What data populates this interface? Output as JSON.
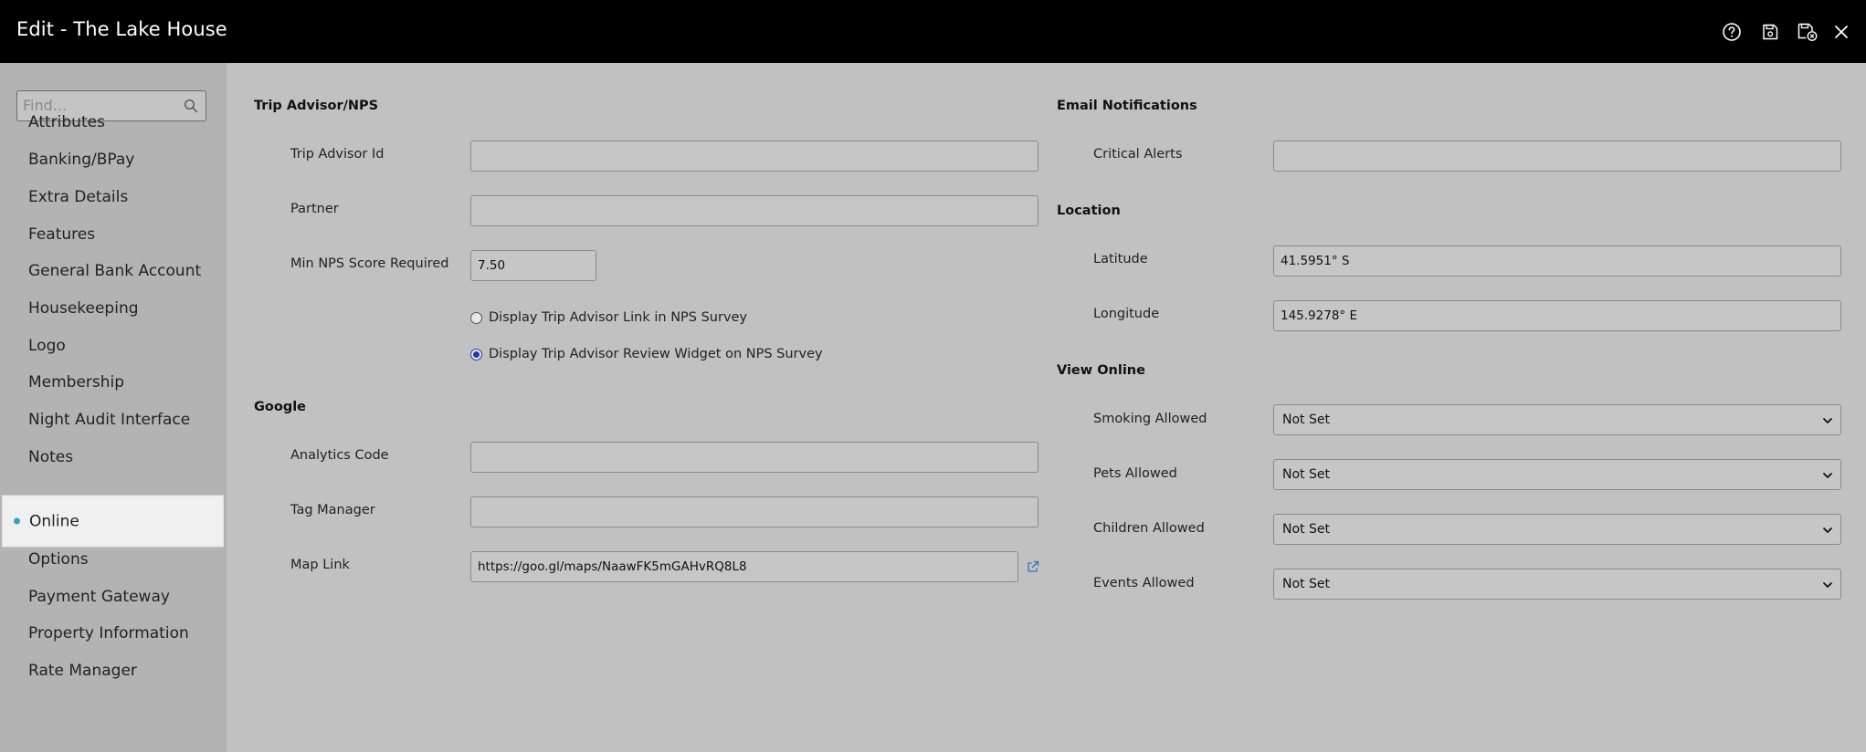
{
  "header": {
    "title": "Edit - The Lake House",
    "icons": [
      "help-icon",
      "save-icon",
      "save-and-close-icon",
      "close-icon"
    ]
  },
  "sidebar": {
    "search_placeholder": "Find...",
    "items": [
      {
        "label": "Attributes"
      },
      {
        "label": "Banking/BPay"
      },
      {
        "label": "Extra Details"
      },
      {
        "label": "Features"
      },
      {
        "label": "General Bank Account"
      },
      {
        "label": "Housekeeping"
      },
      {
        "label": "Logo"
      },
      {
        "label": "Membership"
      },
      {
        "label": "Night Audit Interface"
      },
      {
        "label": "Notes"
      },
      {
        "label": "Online",
        "active": true
      },
      {
        "label": "Options"
      },
      {
        "label": "Payment Gateway"
      },
      {
        "label": "Property Information"
      },
      {
        "label": "Rate Manager"
      }
    ],
    "active_color": "#2aa4cf"
  },
  "trip_advisor": {
    "title": "Trip Advisor/NPS",
    "trip_advisor_id_label": "Trip Advisor Id",
    "trip_advisor_id_value": "",
    "partner_label": "Partner",
    "partner_value": "",
    "min_nps_label": "Min NPS Score Required",
    "min_nps_value": "7.50",
    "radio_link_label": "Display Trip Advisor Link in NPS Survey",
    "radio_widget_label": "Display Trip Advisor Review Widget on NPS Survey",
    "selected_option": "widget"
  },
  "google": {
    "title": "Google",
    "analytics_label": "Analytics Code",
    "analytics_value": "",
    "tag_manager_label": "Tag Manager",
    "tag_manager_value": "",
    "map_link_label": "Map Link",
    "map_link_value": "https://goo.gl/maps/NaawFK5mGAHvRQ8L8"
  },
  "email_notifications": {
    "title": "Email Notifications",
    "critical_alerts_label": "Critical Alerts",
    "critical_alerts_value": ""
  },
  "location": {
    "title": "Location",
    "latitude_label": "Latitude",
    "latitude_value": "41.5951° S",
    "longitude_label": "Longitude",
    "longitude_value": "145.9278° E"
  },
  "view_online": {
    "title": "View Online",
    "smoking_label": "Smoking Allowed",
    "smoking_value": "Not Set",
    "pets_label": "Pets Allowed",
    "pets_value": "Not Set",
    "children_label": "Children Allowed",
    "children_value": "Not Set",
    "events_label": "Events Allowed",
    "events_value": "Not Set"
  }
}
